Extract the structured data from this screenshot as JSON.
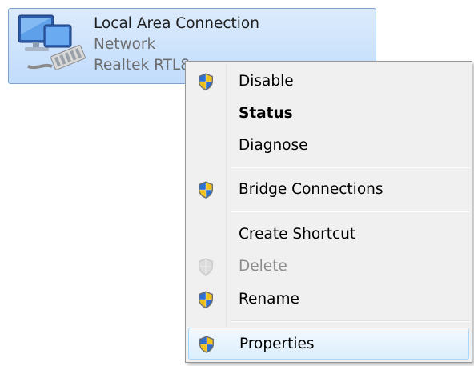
{
  "connection": {
    "name": "Local Area Connection",
    "network": "Network",
    "adapter": "Realtek RTL8",
    "icon": "network-adapter-icon"
  },
  "context_menu": {
    "items": [
      {
        "label": "Disable",
        "icon": "uac-shield-icon"
      },
      {
        "label": "Status",
        "default": true
      },
      {
        "label": "Diagnose"
      },
      {
        "label": "Bridge Connections",
        "icon": "uac-shield-icon"
      },
      {
        "label": "Create Shortcut"
      },
      {
        "label": "Delete",
        "icon": "uac-shield-icon",
        "disabled": true
      },
      {
        "label": "Rename",
        "icon": "uac-shield-icon"
      },
      {
        "label": "Properties",
        "icon": "uac-shield-icon",
        "highlighted": true
      }
    ]
  },
  "colors": {
    "selection_fill": "#c1dcfc",
    "selection_border": "#7da2ce",
    "menu_background": "#f0f0f0",
    "hover_border": "#a8d8fb",
    "disabled_text": "#8d8d8d",
    "shield_blue": "#2f6fd0",
    "shield_yellow": "#f2c21b"
  }
}
